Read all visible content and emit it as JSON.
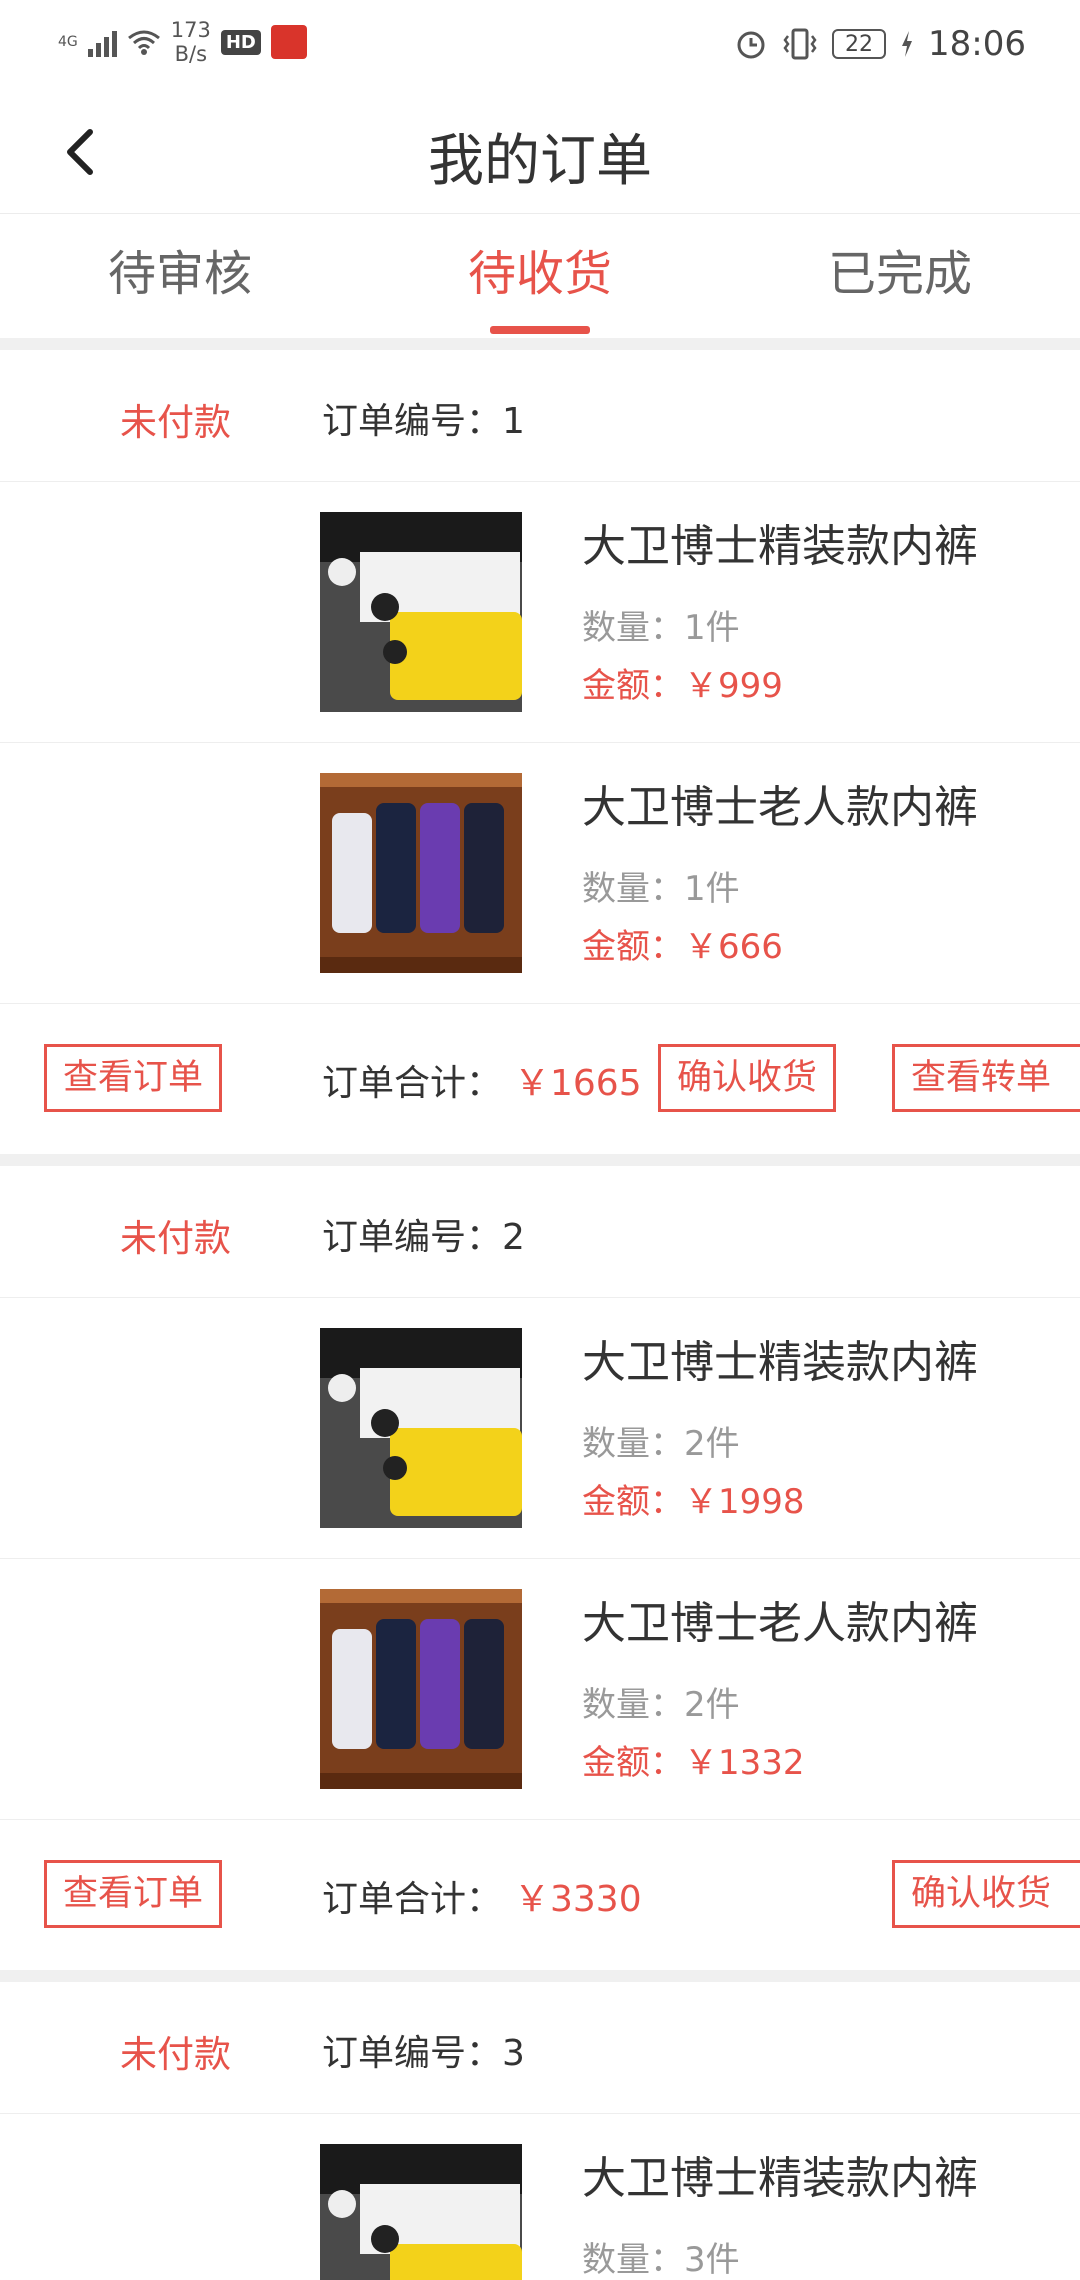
{
  "status_bar": {
    "network": "4G",
    "speed_value": "173",
    "speed_unit": "B/s",
    "hd": "HD",
    "battery": "22",
    "time": "18:06"
  },
  "header": {
    "title": "我的订单"
  },
  "tabs": [
    {
      "label": "待审核"
    },
    {
      "label": "待收货"
    },
    {
      "label": "已完成"
    }
  ],
  "orders": [
    {
      "status": "未付款",
      "order_no": "订单编号：1",
      "items": [
        {
          "name": "大卫博士精装款内裤",
          "qty": "数量：1件",
          "amount": "金额：￥999"
        },
        {
          "name": "大卫博士老人款内裤",
          "qty": "数量：1件",
          "amount": "金额：￥666"
        }
      ],
      "view_button": "查看订单",
      "total_label": "订单合计：",
      "total_value": "￥1665",
      "confirm_button": "确认收货",
      "transfer_button": "查看转单"
    },
    {
      "status": "未付款",
      "order_no": "订单编号：2",
      "items": [
        {
          "name": "大卫博士精装款内裤",
          "qty": "数量：2件",
          "amount": "金额：￥1998"
        },
        {
          "name": "大卫博士老人款内裤",
          "qty": "数量：2件",
          "amount": "金额：￥1332"
        }
      ],
      "view_button": "查看订单",
      "total_label": "订单合计：",
      "total_value": "￥3330",
      "confirm_button": "确认收货"
    },
    {
      "status": "未付款",
      "order_no": "订单编号：3",
      "items": [
        {
          "name": "大卫博士精装款内裤",
          "qty": "数量：3件"
        }
      ]
    }
  ],
  "colors": {
    "accent": "#e7534a",
    "text": "#333333",
    "muted": "#999999",
    "divider": "#eeeeee"
  }
}
